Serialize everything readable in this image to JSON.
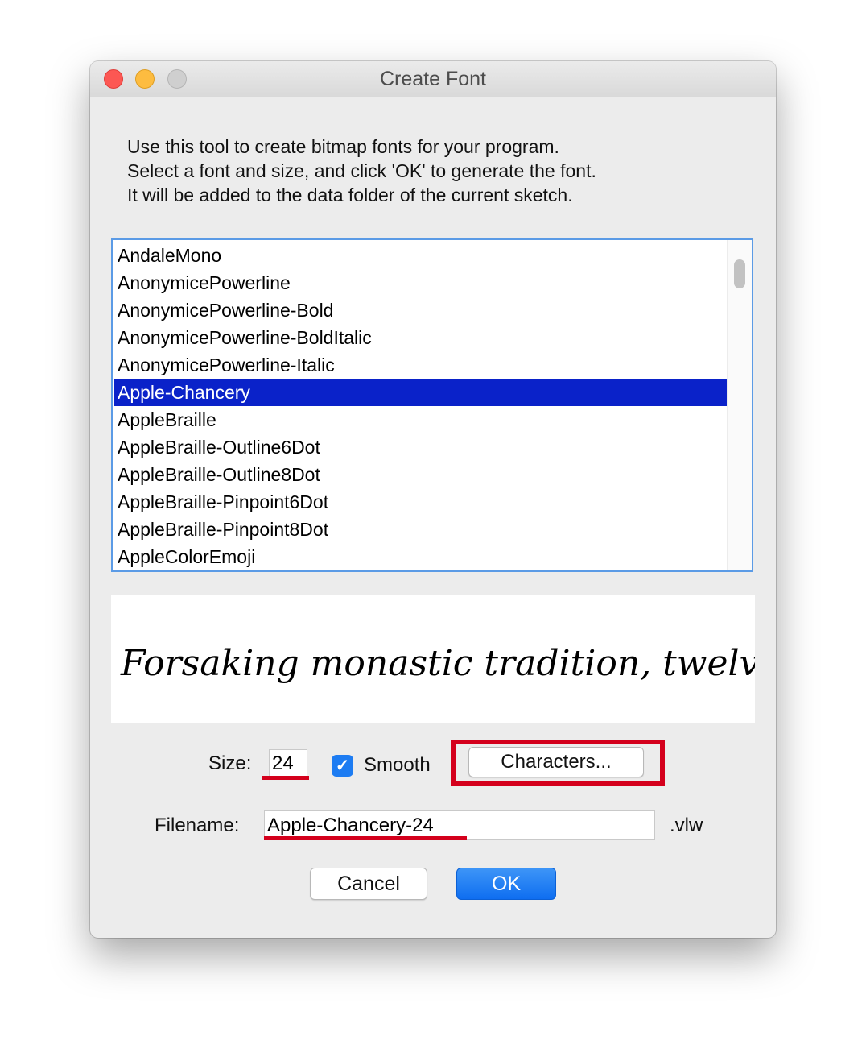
{
  "window": {
    "title": "Create Font"
  },
  "intro": {
    "lines": [
      "Use this tool to create bitmap fonts for your program.",
      "Select a font and size, and click 'OK' to generate the font.",
      "It will be added to the data folder of the current sketch."
    ]
  },
  "font_list": {
    "items": [
      "AndaleMono",
      "AnonymicePowerline",
      "AnonymicePowerline-Bold",
      "AnonymicePowerline-BoldItalic",
      "AnonymicePowerline-Italic",
      "Apple-Chancery",
      "AppleBraille",
      "AppleBraille-Outline6Dot",
      "AppleBraille-Outline8Dot",
      "AppleBraille-Pinpoint6Dot",
      "AppleBraille-Pinpoint8Dot",
      "AppleColorEmoji"
    ],
    "selected": "Apple-Chancery"
  },
  "preview": {
    "text": "Forsaking monastic tradition, twelve jov"
  },
  "controls": {
    "size_label": "Size:",
    "size_value": "24",
    "smooth_label": "Smooth",
    "smooth_checked": true,
    "characters_button": "Characters...",
    "filename_label": "Filename:",
    "filename_value": "Apple-Chancery-24",
    "extension": ".vlw",
    "cancel_button": "Cancel",
    "ok_button": "OK"
  },
  "colors": {
    "selection": "#0a22c9",
    "annotation_red": "#d4001c",
    "ok_blue": "#1a72f1",
    "checkbox_blue": "#1d7cf2"
  }
}
